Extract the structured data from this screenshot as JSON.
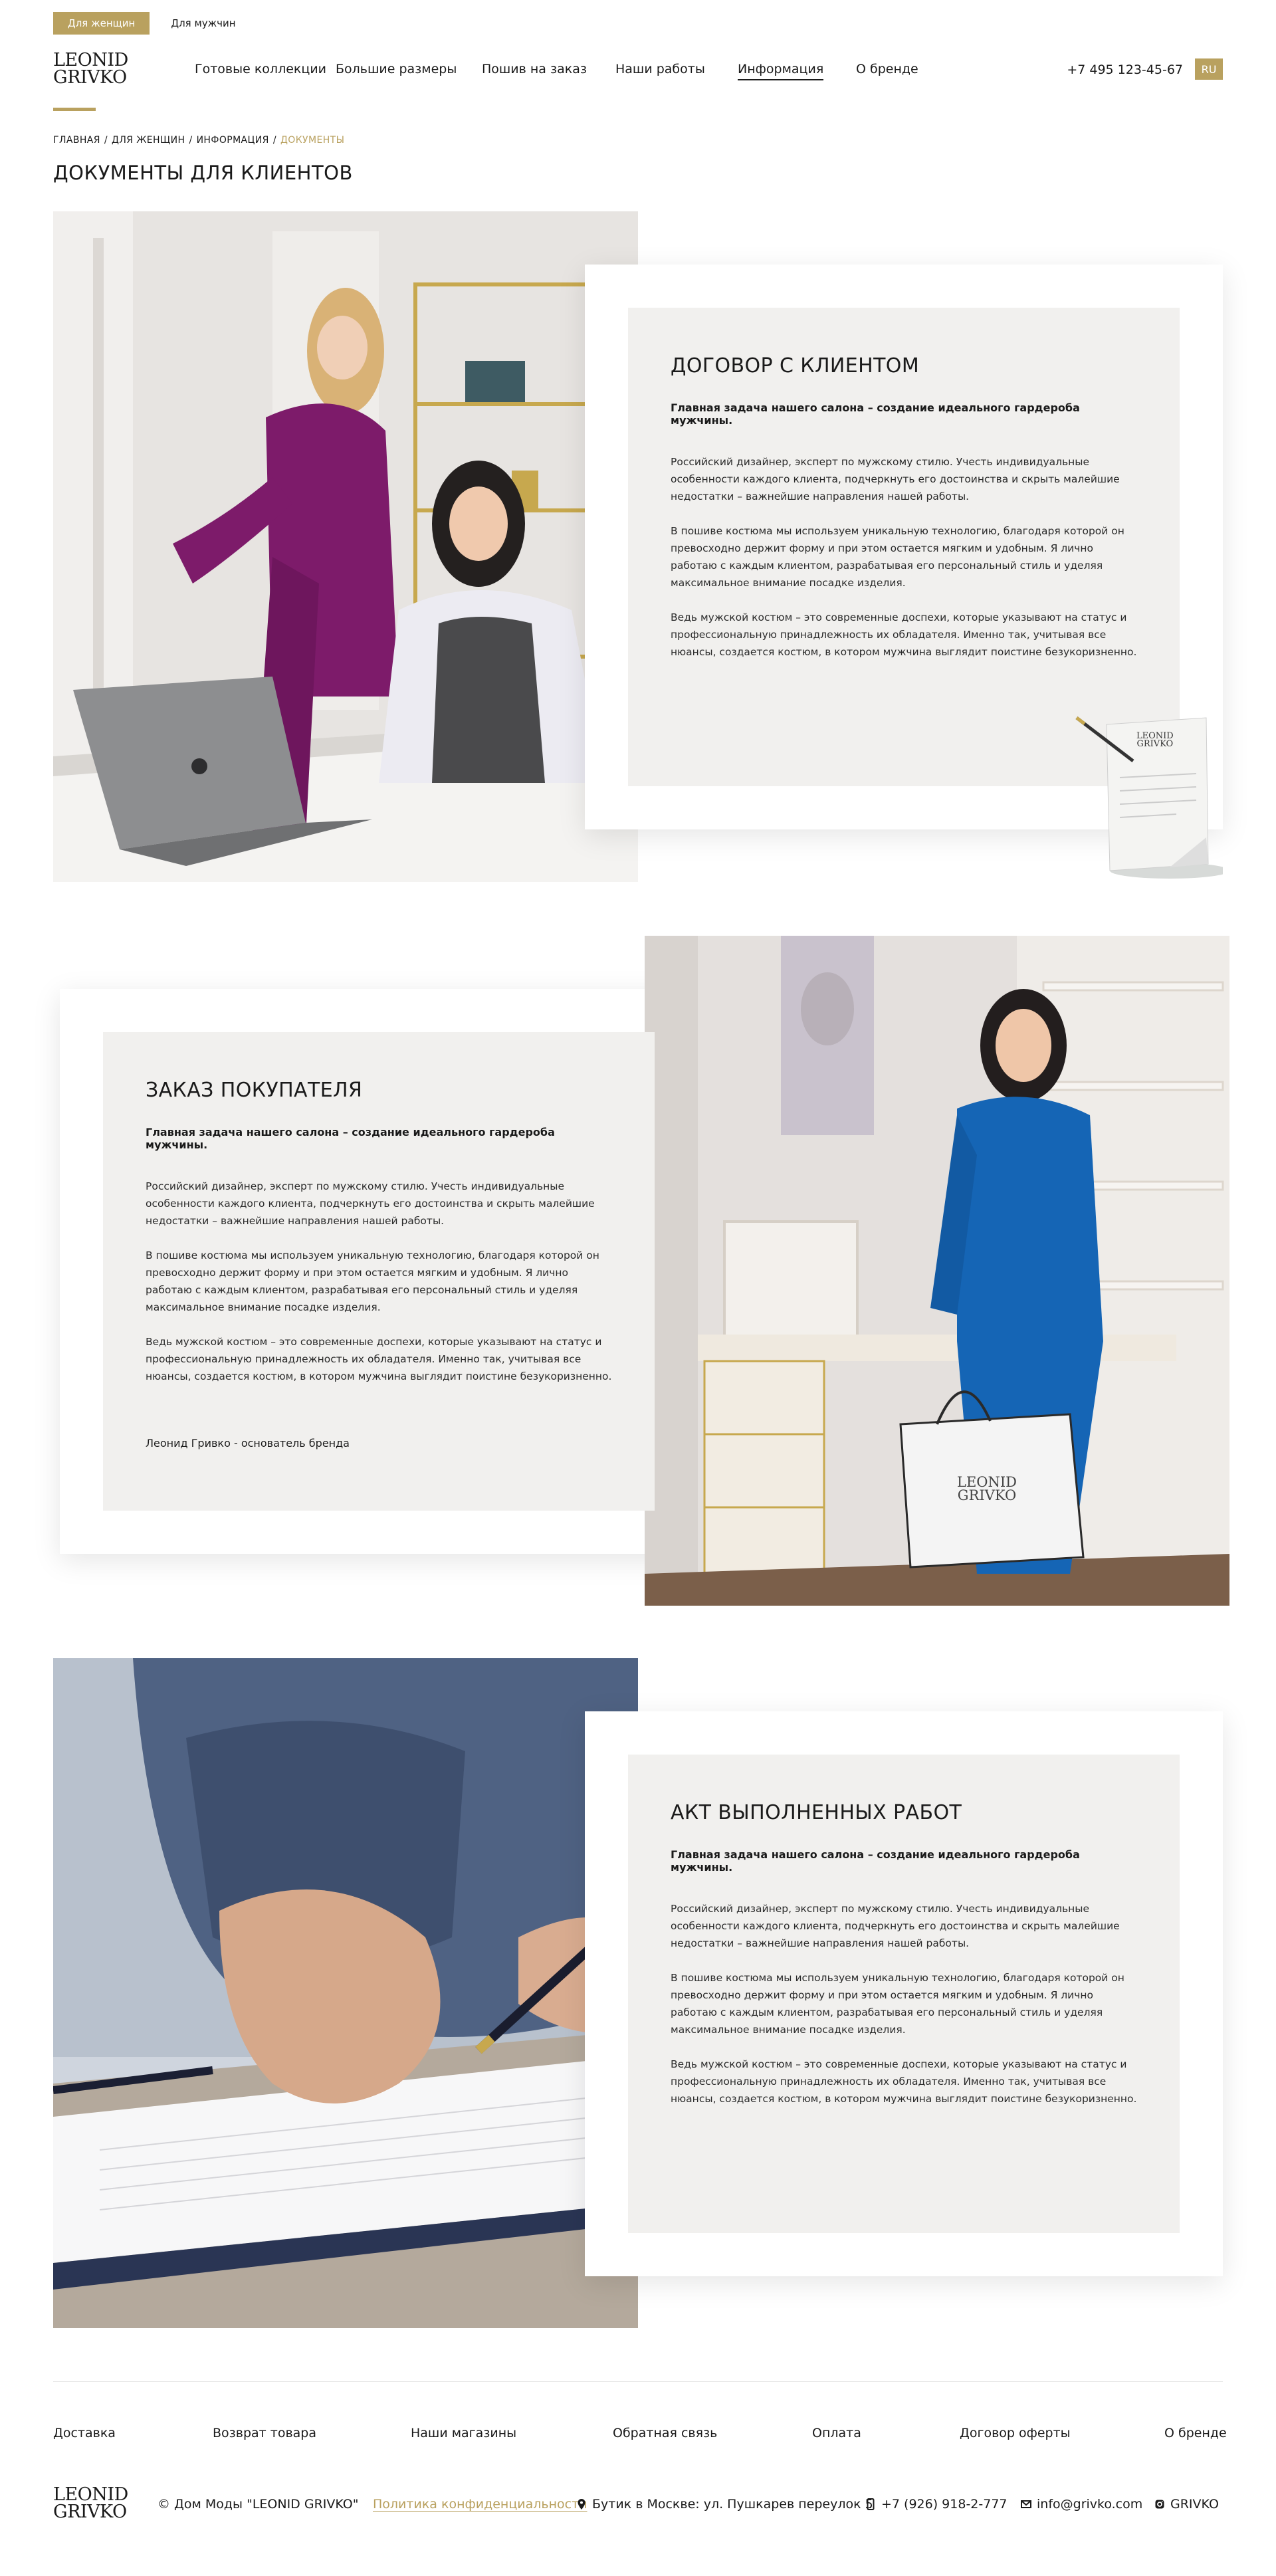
{
  "header": {
    "gender_tabs": [
      {
        "label": "Для женщин",
        "active": true
      },
      {
        "label": "Для мужчин",
        "active": false
      }
    ],
    "logo": {
      "line1": "LEONID",
      "line2": "GRIVKO"
    },
    "nav": [
      {
        "label": "Готовые коллекции",
        "active": false
      },
      {
        "label": "Большие размеры",
        "active": false
      },
      {
        "label": "Пошив на заказ",
        "active": false
      },
      {
        "label": "Наши работы",
        "active": false
      },
      {
        "label": "Информация",
        "active": true
      },
      {
        "label": "О бренде",
        "active": false
      }
    ],
    "phone": "+7 495 123-45-67",
    "lang": "RU"
  },
  "breadcrumb": {
    "items": [
      "ГЛАВНАЯ",
      "ДЛЯ ЖЕНЩИН",
      "ИНФОРМАЦИЯ"
    ],
    "separator": "/",
    "current": "ДОКУМЕНТЫ"
  },
  "page_title": "ДОКУМЕНТЫ ДЛЯ КЛИЕНТОВ",
  "sections": [
    {
      "title": "ДОГОВОР С КЛИЕНТОМ",
      "lead": "Главная задача нашего салона – создание идеального гардероба мужчины.",
      "paragraphs": [
        "Российский дизайнер, эксперт по мужскому стилю. Учесть индивидуальные особенности каждого клиента, подчеркнуть его достоинства и скрыть малейшие недостатки – важнейшие направления нашей работы.",
        "В пошиве костюма мы используем уникальную технологию, благодаря которой он превосходно держит форму и при этом остается мягким и удобным. Я лично работаю с каждым клиентом, разрабатывая его персональный стиль и уделяя максимальное внимание посадке изделия.",
        "Ведь мужской костюм – это современные доспехи, которые указывают на статус и профессиональную принадлежность их обладателя. Именно так, учитывая все нюансы, создается костюм, в котором мужчина выглядит поистине безукоризненно."
      ],
      "signature": "",
      "document_label": {
        "line1": "LEONID",
        "line2": "GRIVKO"
      }
    },
    {
      "title": "ЗАКАЗ ПОКУПАТЕЛЯ",
      "lead": "Главная задача нашего салона – создание идеального гардероба мужчины.",
      "paragraphs": [
        "Российский дизайнер, эксперт по мужскому стилю. Учесть индивидуальные особенности каждого клиента, подчеркнуть его достоинства и скрыть малейшие недостатки – важнейшие направления нашей работы.",
        "В пошиве костюма мы используем уникальную технологию, благодаря которой он превосходно держит форму и при этом остается мягким и удобным. Я лично работаю с каждым клиентом, разрабатывая его персональный стиль и уделяя максимальное внимание посадке изделия.",
        "Ведь мужской костюм – это современные доспехи, которые указывают на статус и профессиональную принадлежность их обладателя. Именно так, учитывая все нюансы, создается костюм, в котором мужчина выглядит поистине безукоризненно."
      ],
      "signature": "Леонид Гривко - основатель бренда",
      "bag_label": {
        "line1": "LEONID",
        "line2": "GRIVKO"
      }
    },
    {
      "title": "АКТ ВЫПОЛНЕННЫХ РАБОТ",
      "lead": "Главная задача нашего салона – создание идеального гардероба мужчины.",
      "paragraphs": [
        "Российский дизайнер, эксперт по мужскому стилю. Учесть индивидуальные особенности каждого клиента, подчеркнуть его достоинства и скрыть малейшие недостатки – важнейшие направления нашей работы.",
        "В пошиве костюма мы используем уникальную технологию, благодаря которой он превосходно держит форму и при этом остается мягким и удобным. Я лично работаю с каждым клиентом, разрабатывая его персональный стиль и уделяя максимальное внимание посадке изделия.",
        "Ведь мужской костюм – это современные доспехи, которые указывают на статус и профессиональную принадлежность их обладателя. Именно так, учитывая все нюансы, создается костюм, в котором мужчина выглядит поистине безукоризненно."
      ],
      "signature": ""
    }
  ],
  "footer": {
    "nav": [
      "Доставка",
      "Возврат товара",
      "Наши магазины",
      "Обратная связь",
      "Оплата",
      "Договор оферты",
      "О бренде"
    ],
    "logo": {
      "line1": "LEONID",
      "line2": "GRIVKO"
    },
    "copyright": "© Дом Моды \"LEONID GRIVKO\"",
    "privacy": "Политика конфиденциальности",
    "address": "Бутик в Москве: ул. Пушкарев переулок 5",
    "phone": "+7 (926) 918-2-777",
    "email": "info@grivko.com",
    "instagram": "GRIVKO",
    "icons": {
      "address": "map-pin-icon",
      "phone": "mobile-phone-icon",
      "email": "envelope-icon",
      "instagram": "instagram-icon"
    }
  },
  "colors": {
    "accent": "#b9a15f",
    "text": "#1a1a1a",
    "card_bg": "#f1f0ee"
  }
}
